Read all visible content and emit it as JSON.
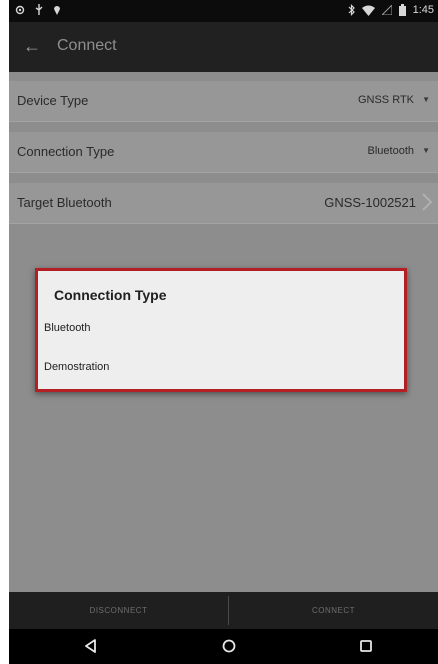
{
  "status_bar": {
    "left_icons": [
      "settings-icon",
      "usb-icon",
      "location-pin-icon"
    ],
    "right_icons": [
      "bluetooth-icon",
      "wifi-icon",
      "signal-icon",
      "battery-icon"
    ],
    "time": "1:45"
  },
  "app_bar": {
    "back_icon": "back-arrow-icon",
    "title": "Connect"
  },
  "settings": [
    {
      "label": "Device Type",
      "value": "GNSS RTK",
      "control": "dropdown"
    },
    {
      "label": "Connection Type",
      "value": "Bluetooth",
      "control": "dropdown"
    },
    {
      "label": "Target Bluetooth",
      "value": "GNSS-1002521",
      "control": "chevron"
    }
  ],
  "dialog": {
    "title": "Connection Type",
    "options": [
      "Bluetooth",
      "Demostration"
    ],
    "highlight_color": "#b21f24"
  },
  "bottom_bar": {
    "disconnect_label": "DISCONNECT",
    "connect_label": "CONNECT"
  },
  "nav_bar": {
    "icons": [
      "back-triangle-icon",
      "home-circle-icon",
      "recents-square-icon"
    ]
  }
}
